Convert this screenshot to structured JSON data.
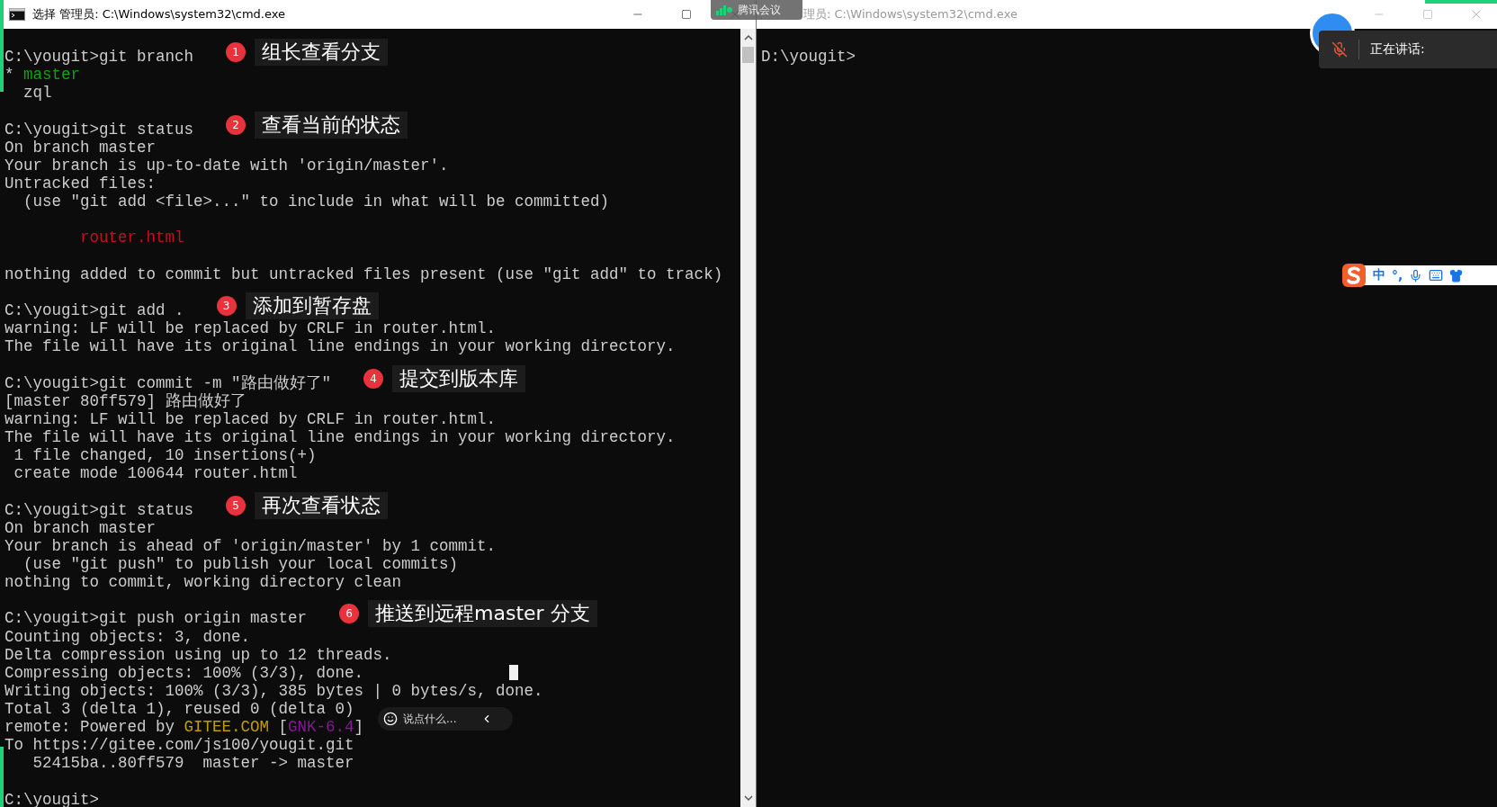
{
  "left_window": {
    "title": "选择 管理员: C:\\Windows\\system32\\cmd.exe",
    "blocks": [
      {
        "lines": [
          {
            "text": "C:\\yougit>git branch",
            "note": {
              "number": "1",
              "text": "组长查看分支"
            }
          },
          {
            "segments": [
              {
                "text": "* ",
                "color": "#cccccc"
              },
              {
                "text": "master",
                "color": "#13a10e"
              }
            ]
          },
          {
            "text": "  zql"
          }
        ]
      },
      {
        "lines": [
          {
            "text": "C:\\yougit>git status",
            "note": {
              "number": "2",
              "text": "查看当前的状态"
            }
          },
          {
            "text": "On branch master"
          },
          {
            "text": "Your branch is up-to-date with 'origin/master'."
          },
          {
            "text": "Untracked files:"
          },
          {
            "text": "  (use \"git add <file>...\" to include in what will be committed)"
          }
        ]
      },
      {
        "lines": [
          {
            "segments": [
              {
                "text": "        router.html",
                "color": "#c50f1f"
              }
            ]
          }
        ]
      },
      {
        "lines": [
          {
            "text": "nothing added to commit but untracked files present (use \"git add\" to track)"
          }
        ]
      },
      {
        "lines": [
          {
            "text": "C:\\yougit>git add .",
            "note": {
              "number": "3",
              "text": "添加到暂存盘"
            }
          },
          {
            "text": "warning: LF will be replaced by CRLF in router.html."
          },
          {
            "text": "The file will have its original line endings in your working directory."
          }
        ]
      },
      {
        "lines": [
          {
            "text": "C:\\yougit>git commit -m \"路由做好了\"",
            "note": {
              "number": "4",
              "text": "提交到版本库"
            }
          },
          {
            "text": "[master 80ff579] 路由做好了"
          },
          {
            "text": "warning: LF will be replaced by CRLF in router.html."
          },
          {
            "text": "The file will have its original line endings in your working directory."
          },
          {
            "text": " 1 file changed, 10 insertions(+)"
          },
          {
            "text": " create mode 100644 router.html"
          }
        ]
      },
      {
        "lines": [
          {
            "text": "C:\\yougit>git status",
            "note": {
              "number": "5",
              "text": "再次查看状态"
            }
          },
          {
            "text": "On branch master"
          },
          {
            "text": "Your branch is ahead of 'origin/master' by 1 commit."
          },
          {
            "text": "  (use \"git push\" to publish your local commits)"
          },
          {
            "text": "nothing to commit, working directory clean"
          }
        ]
      },
      {
        "lines": [
          {
            "text": "C:\\yougit>git push origin master",
            "note": {
              "number": "6",
              "text": "推送到远程master 分支"
            }
          },
          {
            "text": "Counting objects: 3, done."
          },
          {
            "text": "Delta compression using up to 12 threads."
          },
          {
            "text": "Compressing objects: 100% (3/3), done.",
            "cursor": true
          },
          {
            "text": "Writing objects: 100% (3/3), 385 bytes | 0 bytes/s, done."
          },
          {
            "text": "Total 3 (delta 1), reused 0 (delta 0)"
          },
          {
            "segments": [
              {
                "text": "remote: Powered by ",
                "color": "#cccccc"
              },
              {
                "text": "GITEE.COM",
                "color": "#c19c00"
              },
              {
                "text": " [",
                "color": "#cccccc"
              },
              {
                "text": "GNK-6.4",
                "color": "#881798"
              },
              {
                "text": "]",
                "color": "#cccccc"
              }
            ]
          },
          {
            "text": "To https://gitee.com/js100/yougit.git"
          },
          {
            "text": "   52415ba..80ff579  master -> master"
          }
        ]
      },
      {
        "lines": [
          {
            "text": "C:\\yougit>"
          }
        ]
      }
    ]
  },
  "right_window": {
    "title": "理员: C:\\Windows\\system32\\cmd.exe",
    "blocks": [
      {
        "lines": [
          {
            "text": "D:\\yougit>"
          }
        ]
      }
    ]
  },
  "meeting_bar": {
    "title": "腾讯会议"
  },
  "speaking_panel": {
    "label": "正在讲话:",
    "muted": true
  },
  "ime_toolbar": {
    "mode": "中",
    "punctuation": "°,"
  },
  "chat_box": {
    "placeholder": "说点什么..."
  }
}
